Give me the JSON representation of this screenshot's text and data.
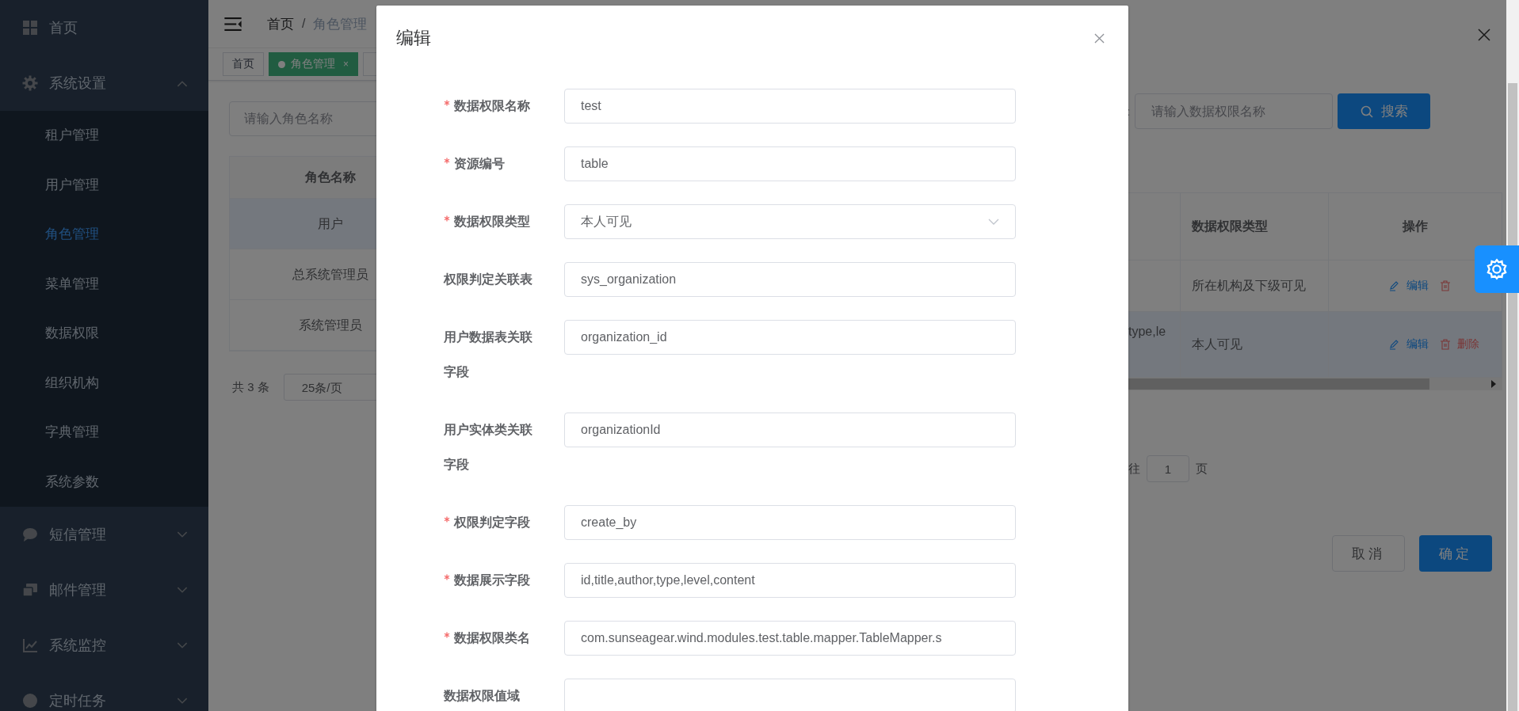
{
  "sidebar": {
    "items": [
      {
        "label": "首页"
      },
      {
        "label": "系统设置",
        "expanded": true,
        "children": [
          {
            "label": "租户管理",
            "selected": false
          },
          {
            "label": "用户管理",
            "selected": false
          },
          {
            "label": "角色管理",
            "selected": true
          },
          {
            "label": "菜单管理",
            "selected": false
          },
          {
            "label": "数据权限",
            "selected": false
          },
          {
            "label": "组织机构",
            "selected": false
          },
          {
            "label": "字典管理",
            "selected": false
          },
          {
            "label": "系统参数",
            "selected": false
          }
        ]
      },
      {
        "label": "短信管理",
        "expanded": false
      },
      {
        "label": "邮件管理",
        "expanded": false
      },
      {
        "label": "系统监控",
        "expanded": false
      },
      {
        "label": "定时任务",
        "expanded": false
      }
    ]
  },
  "breadcrumb": [
    "首页",
    "角色管理"
  ],
  "breadcrumb_separator": "/",
  "tags": [
    {
      "label": "首页",
      "selected": false
    },
    {
      "label": "角色管理",
      "selected": true,
      "close": "×"
    }
  ],
  "role_search": {
    "placeholder": "请输入角色名称"
  },
  "role_table": {
    "columns": [
      "角色名称"
    ],
    "rows": [
      {
        "name": "用户",
        "selected": true
      },
      {
        "name": "总系统管理员",
        "selected": false
      },
      {
        "name": "系统管理员",
        "selected": false
      }
    ]
  },
  "role_pagination": {
    "total": "共 3 条",
    "page_size": "25条/页"
  },
  "drawer": {
    "search_label": ":",
    "search_placeholder": "请输入数据权限名称",
    "search_button": "搜索",
    "columns": [
      "数据权限类型",
      "操作"
    ],
    "rows": [
      {
        "type": "所在机构及下级可见",
        "edit": "编辑",
        "selected": false
      },
      {
        "column_1": "type,le",
        "type": "本人可见",
        "edit": "编辑",
        "delete": "删除",
        "selected": true
      }
    ],
    "goto": {
      "prefix": "往",
      "page": "1",
      "suffix": "页"
    },
    "buttons": {
      "cancel": "取消",
      "confirm": "确定"
    }
  },
  "dialog": {
    "title": "编辑",
    "fields": [
      {
        "label": "数据权限名称",
        "required": true,
        "kind": "input",
        "value": "test"
      },
      {
        "label": "资源编号",
        "required": true,
        "kind": "input",
        "value": "table"
      },
      {
        "label": "数据权限类型",
        "required": true,
        "kind": "select",
        "value": "本人可见"
      },
      {
        "label": "权限判定关联表",
        "required": false,
        "kind": "input",
        "value": "sys_organization"
      },
      {
        "label": "用户数据表关联字段",
        "required": false,
        "kind": "input",
        "value": "organization_id"
      },
      {
        "label": "用户实体类关联字段",
        "required": false,
        "kind": "input",
        "value": "organizationId"
      },
      {
        "label": "权限判定字段",
        "required": true,
        "kind": "input",
        "value": "create_by"
      },
      {
        "label": "数据展示字段",
        "required": true,
        "kind": "input",
        "value": "id,title,author,type,level,content"
      },
      {
        "label": "数据权限类名",
        "required": true,
        "kind": "input",
        "value": "com.sunseagear.wind.modules.test.table.mapper.TableMapper.s"
      },
      {
        "label": "数据权限值域",
        "required": false,
        "kind": "input"
      }
    ]
  }
}
